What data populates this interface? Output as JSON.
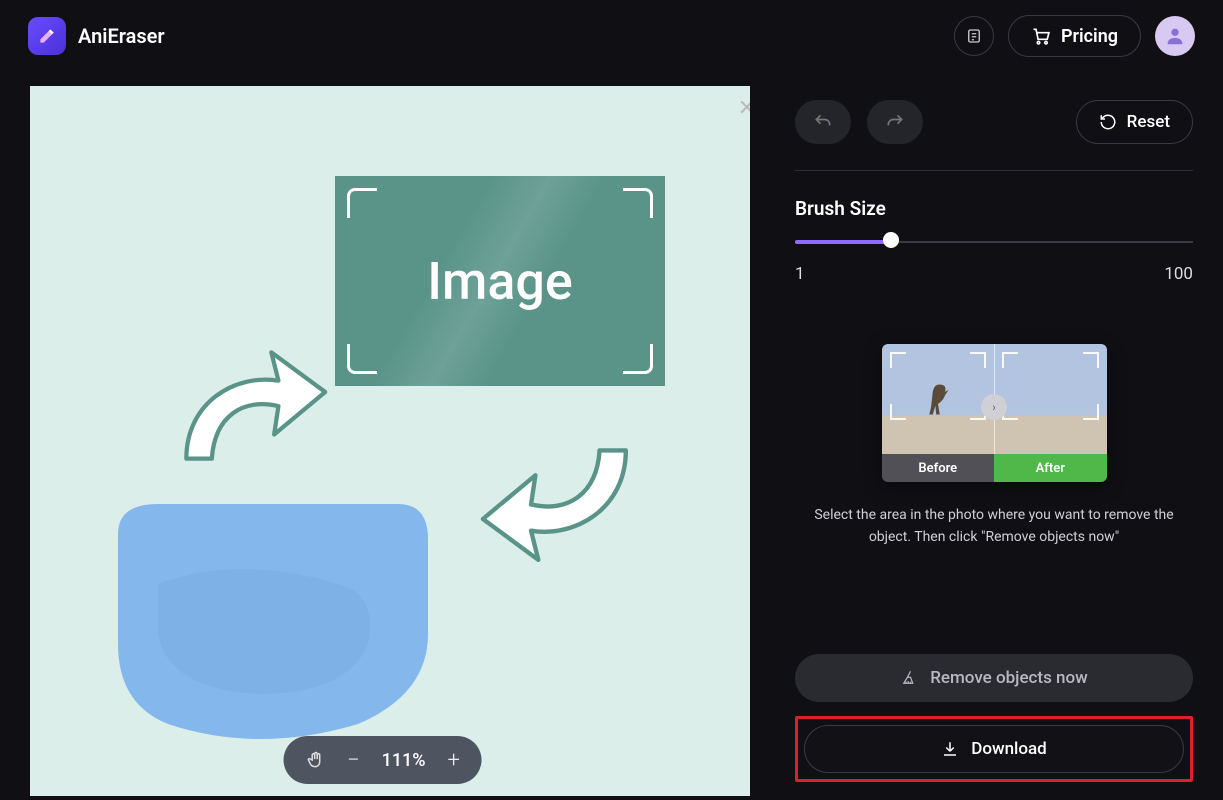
{
  "header": {
    "brand": "AniEraser",
    "pricing": "Pricing"
  },
  "canvas": {
    "image_label": "Image",
    "zoom": "111%"
  },
  "panel": {
    "reset": "Reset",
    "brush_label": "Brush Size",
    "brush_min": "1",
    "brush_max": "100",
    "before": "Before",
    "after": "After",
    "hint": "Select the area in the photo where you want to remove the object. Then click \"Remove objects now\"",
    "remove": "Remove objects now",
    "download": "Download"
  }
}
